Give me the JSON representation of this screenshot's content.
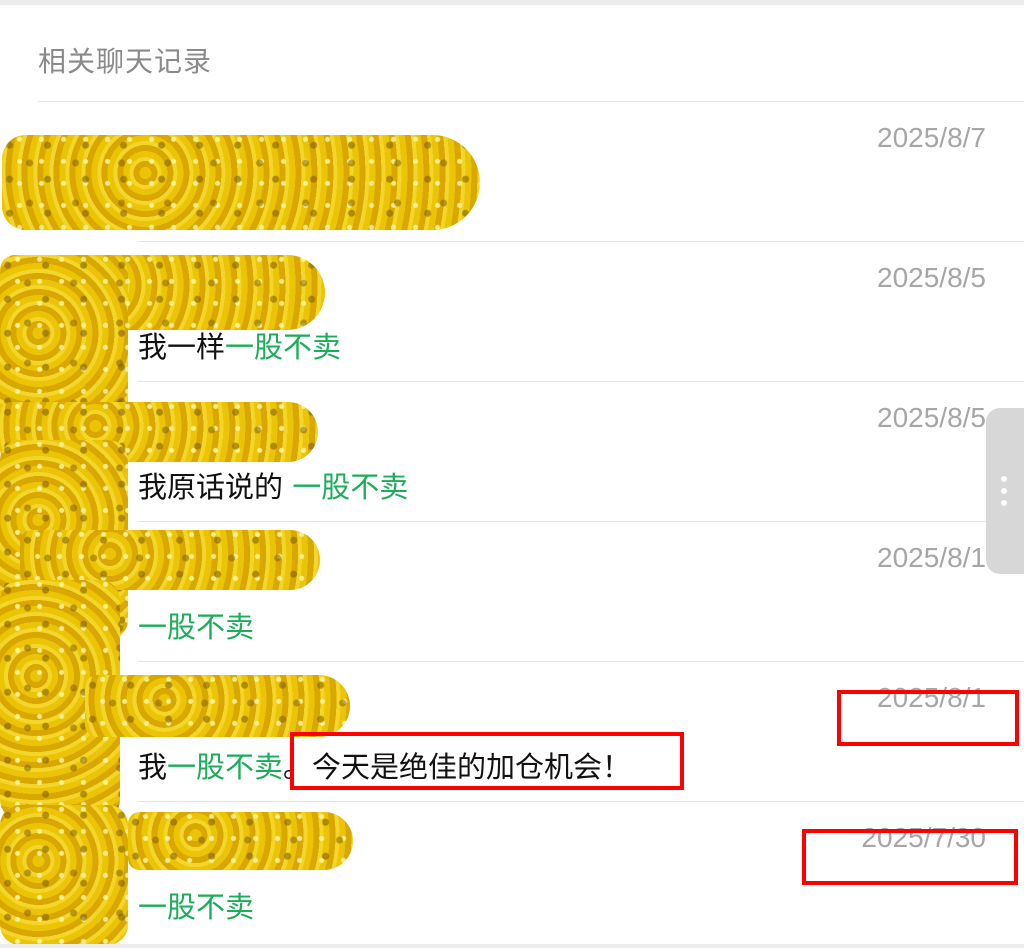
{
  "header": {
    "title": "相关聊天记录"
  },
  "messages": [
    {
      "date": "2025/8/7",
      "pre": "",
      "highlight": "",
      "post": ""
    },
    {
      "date": "2025/8/5",
      "pre": "我一样",
      "highlight": "一股不卖",
      "post": ""
    },
    {
      "date": "2025/8/5",
      "pre": "我原话说的 ",
      "highlight": "一股不卖",
      "post": ""
    },
    {
      "date": "2025/8/1",
      "pre": "",
      "highlight": "一股不卖",
      "post": ""
    },
    {
      "date": "2025/8/1",
      "pre": "我",
      "highlight": "一股不卖",
      "post": "。今天是绝佳的加仓机会！"
    },
    {
      "date": "2025/7/30",
      "pre": "",
      "highlight": "一股不卖",
      "post": ""
    }
  ],
  "colors": {
    "highlight": "#1aad5a",
    "annotation": "#ff0000",
    "redaction": "#e8c417"
  },
  "icons": {
    "scroll_handle": "vertical-ellipsis-icon"
  }
}
